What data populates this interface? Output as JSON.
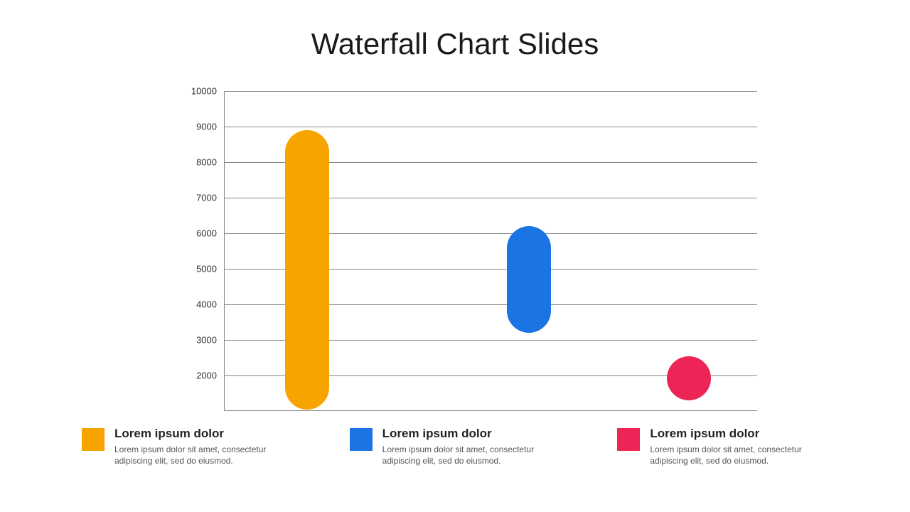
{
  "title": "Waterfall Chart Slides",
  "chart_data": {
    "type": "bar",
    "title": "Waterfall Chart Slides",
    "xlabel": "",
    "ylabel": "",
    "ylim": [
      1000,
      10000
    ],
    "y_ticks": [
      1000,
      2000,
      3000,
      4000,
      5000,
      6000,
      7000,
      8000,
      9000,
      10000
    ],
    "y_tick_labels": [
      "",
      "2000",
      "3000",
      "4000",
      "5000",
      "6000",
      "7000",
      "8000",
      "9000",
      "10000"
    ],
    "grid": true,
    "series": [
      {
        "name": "Lorem ipsum dolor",
        "color": "#f7a300",
        "low": 1050,
        "high": 8900
      },
      {
        "name": "Lorem ipsum dolor",
        "color": "#1b74e4",
        "low": 3200,
        "high": 6200
      },
      {
        "name": "Lorem ipsum dolor",
        "color": "#ec2556",
        "low": 1300,
        "high": 2550
      }
    ]
  },
  "legend": [
    {
      "title": "Lorem ipsum dolor",
      "desc": "Lorem ipsum dolor sit amet, consectetur adipiscing elit, sed do eiusmod.",
      "color": "#f7a300"
    },
    {
      "title": "Lorem ipsum dolor",
      "desc": "Lorem ipsum dolor sit amet, consectetur adipiscing elit, sed do eiusmod.",
      "color": "#1b74e4"
    },
    {
      "title": "Lorem ipsum dolor",
      "desc": "Lorem ipsum dolor sit amet, consectetur adipiscing elit, sed do eiusmod.",
      "color": "#ec2556"
    }
  ]
}
